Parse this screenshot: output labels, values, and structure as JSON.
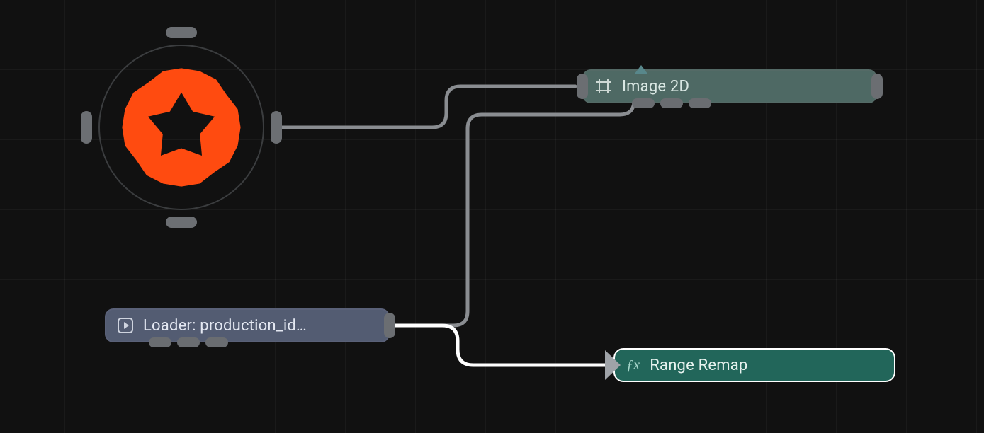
{
  "nodes": {
    "image2d": {
      "label": "Image 2D"
    },
    "loader": {
      "label": "Loader: production_id…"
    },
    "range": {
      "label": "Range Remap",
      "fx": "ƒx"
    }
  },
  "colors": {
    "wire_default": "#8a8d91",
    "wire_active": "#ffffff",
    "gear": "#ff4b10"
  }
}
